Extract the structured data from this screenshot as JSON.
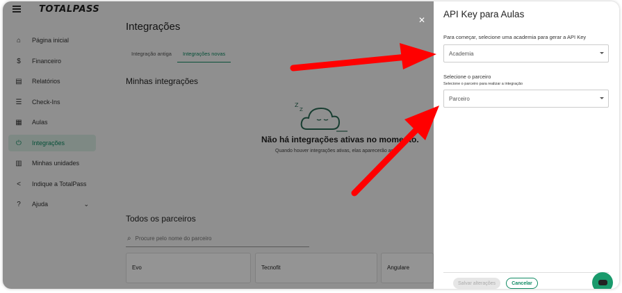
{
  "app": {
    "logo": "TOTALPASS"
  },
  "sidebar": {
    "items": [
      {
        "label": "Página inicial",
        "icon": "home-icon"
      },
      {
        "label": "Financeiro",
        "icon": "dollar-icon"
      },
      {
        "label": "Relatórios",
        "icon": "report-icon"
      },
      {
        "label": "Check-Ins",
        "icon": "checklist-icon"
      },
      {
        "label": "Aulas",
        "icon": "calendar-icon"
      },
      {
        "label": "Integrações",
        "icon": "plug-icon",
        "active": true
      },
      {
        "label": "Minhas unidades",
        "icon": "store-icon"
      },
      {
        "label": "Indique a TotalPass",
        "icon": "share-icon"
      },
      {
        "label": "Ajuda",
        "icon": "help-icon"
      }
    ]
  },
  "main": {
    "title": "Integrações",
    "tabs": [
      "Integração antiga",
      "Integrações novas"
    ],
    "my_integrations_title": "Minhas integrações",
    "empty_title": "Não há integrações ativas no momento.",
    "empty_subtitle": "Quando houver integrações ativas, elas aparecerão aqui.",
    "all_partners_title": "Todos os parceiros",
    "search_placeholder": "Procure pelo nome do parceiro",
    "partners": [
      "Evo",
      "Tecnofit",
      "Angulare"
    ]
  },
  "drawer": {
    "title": "API Key para Aulas",
    "gym_label": "Para começar, selecione uma academia para gerar a API Key",
    "gym_placeholder": "Academia",
    "partner_label": "Selecione o parceiro",
    "partner_sublabel": "Selecione o parceiro para realizar a integração",
    "partner_placeholder": "Parceiro",
    "save_label": "Salvar alterações",
    "cancel_label": "Cancelar"
  },
  "colors": {
    "accent": "#0f8a63",
    "annotation": "#ff0000"
  }
}
